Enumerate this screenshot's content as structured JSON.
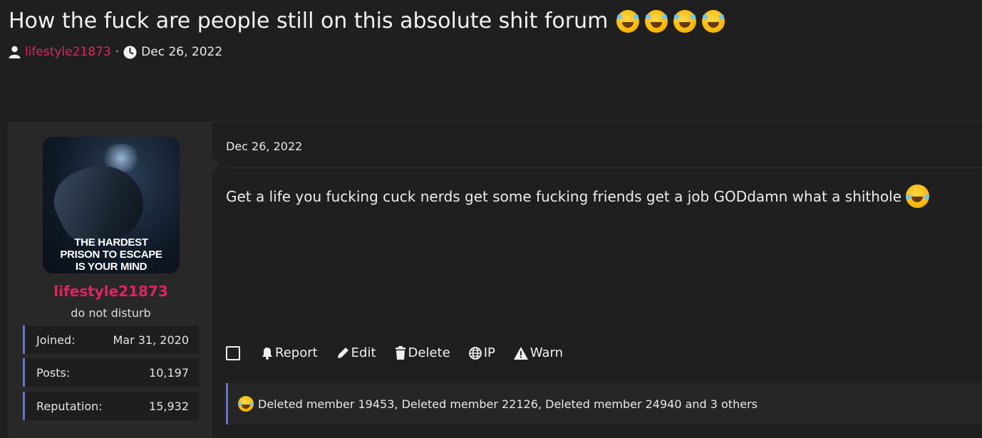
{
  "thread": {
    "title": "How the fuck are people still on this absolute shit forum",
    "title_emojis": [
      "rofl-emoji",
      "rofl-emoji",
      "rofl-emoji",
      "rofl-emoji"
    ],
    "author": "lifestyle21873",
    "separator": "·",
    "date": "Dec 26, 2022"
  },
  "user": {
    "avatar_caption_line1": "THE HARDEST",
    "avatar_caption_line2": "PRISON TO ESCAPE",
    "avatar_caption_line3": "IS YOUR MIND",
    "username": "lifestyle21873",
    "title": "do not disturb",
    "stats": [
      {
        "label": "Joined:",
        "value": "Mar 31, 2020"
      },
      {
        "label": "Posts:",
        "value": "10,197"
      },
      {
        "label": "Reputation:",
        "value": "15,932"
      }
    ]
  },
  "post": {
    "date": "Dec 26, 2022",
    "body": "Get a life you fucking cuck nerds get some fucking friends get a job GODdamn what a shithole",
    "body_emoji": "joy-emoji"
  },
  "actions": {
    "report": "Report",
    "edit": "Edit",
    "delete": "Delete",
    "ip": "IP",
    "warn": "Warn"
  },
  "reactions": {
    "emoji": "joy-emoji",
    "text": "Deleted member 19453, Deleted member 22126, Deleted member 24940 and 3 others"
  },
  "colors": {
    "background": "#1f1f1f",
    "sidebar": "#282828",
    "username": "#e0245e",
    "accent": "#6a74c9"
  }
}
